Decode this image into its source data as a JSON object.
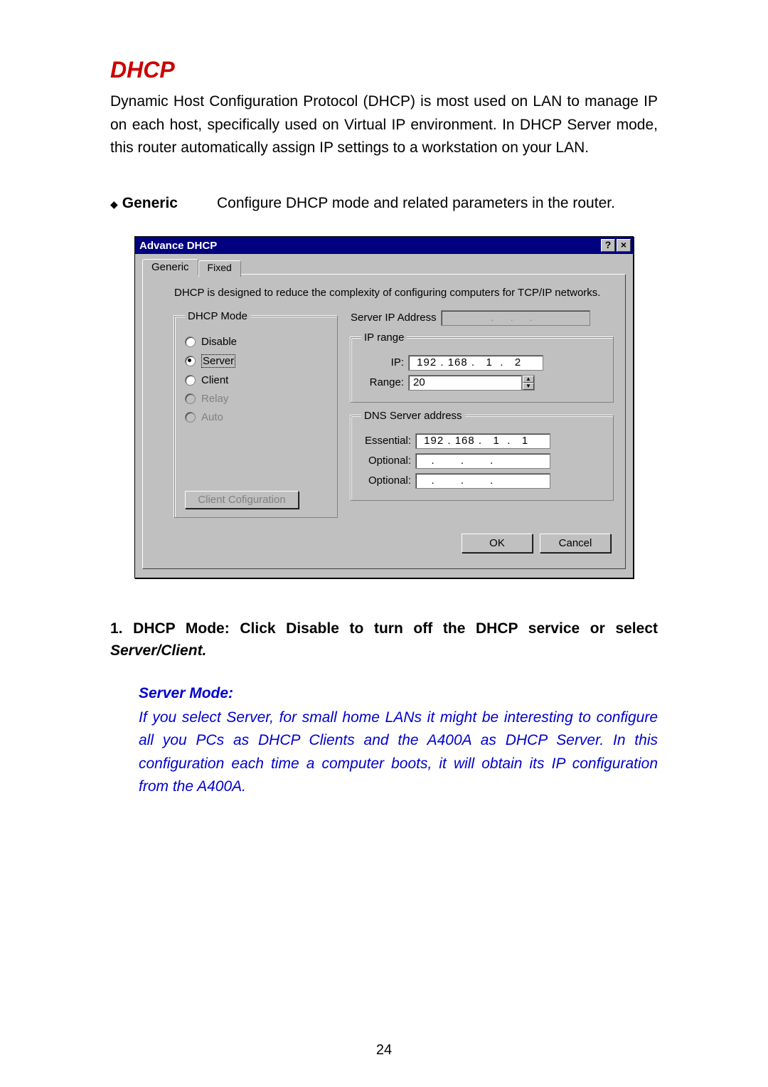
{
  "section_title": "DHCP",
  "intro_text": "Dynamic Host Configuration Protocol (DHCP) is most used on LAN to manage IP on each host, specifically used on Virtual IP environment. In DHCP Server mode, this router automatically assign IP settings to a workstation on your LAN.",
  "generic": {
    "label": "Generic",
    "desc": "Configure DHCP mode and related parameters in the router."
  },
  "dialog": {
    "title": "Advance DHCP",
    "help_btn": "?",
    "close_btn": "×",
    "tabs": {
      "active": "Generic",
      "inactive": "Fixed"
    },
    "description": "DHCP is designed to reduce the complexity of configuring computers for TCP/IP networks.",
    "mode_group_label": "DHCP Mode",
    "modes": {
      "disable": "Disable",
      "server": "Server",
      "client": "Client",
      "relay": "Relay",
      "auto": "Auto"
    },
    "client_config_btn": "Client Cofiguration",
    "server_ip_label": "Server IP Address",
    "server_ip_value": ".   .   .",
    "ip_range_group": "IP range",
    "ip_label": "IP:",
    "ip_value": " 192 . 168 .   1  .   2",
    "range_label": "Range:",
    "range_value": "20",
    "dns_group": "DNS Server address",
    "essential_label": "Essential:",
    "essential_value": " 192 . 168 .   1  .   1",
    "optional_label": "Optional:",
    "optional1_value": "   .       .       .   ",
    "optional2_value": "   .       .       .   ",
    "ok_btn": "OK",
    "cancel_btn": "Cancel"
  },
  "numbered_prefix": "1.  DHCP  Mode:  Click  Disable  to  turn  off  the  DHCP  service  or select  ",
  "numbered_italic": "Server/Client.",
  "server_mode_heading": "Server  Mode:",
  "server_mode_text": "If  you  select  Server,  for  small  home  LANs  it  might  be  interesting to  configure  all  you  PCs  as  DHCP  Clients  and  the  A400A  as DHCP  Server.    In  this  configuration  each  time  a  computer  boots, it  will  obtain  its  IP  configuration  from  the  A400A.",
  "page_number": "24"
}
